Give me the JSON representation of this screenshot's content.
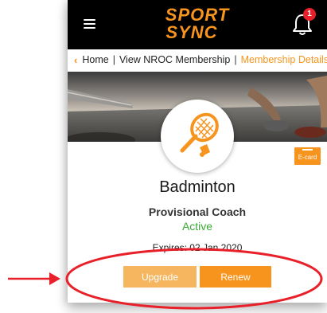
{
  "header": {
    "logo_line1": "SPORT",
    "logo_line2": "SYNC",
    "notification_count": "1"
  },
  "breadcrumb": {
    "items": [
      "Home",
      "View NROC Membership",
      "Membership Details"
    ],
    "separator": "|"
  },
  "membership": {
    "sport": "Badminton",
    "role": "Provisional Coach",
    "status": "Active",
    "expires": "Expires: 02 Jan 2020",
    "ecard_label": "E-card"
  },
  "actions": {
    "upgrade_label": "Upgrade",
    "renew_label": "Renew"
  },
  "colors": {
    "accent": "#f7941d",
    "accent_light": "#f6b660",
    "status_active": "#3aaa35",
    "badge": "#e8202a",
    "annotation": "#e8202a"
  },
  "icons": [
    "menu-icon",
    "bell-icon",
    "badminton-racket-icon",
    "e-card-icon",
    "chevron-left-icon"
  ]
}
